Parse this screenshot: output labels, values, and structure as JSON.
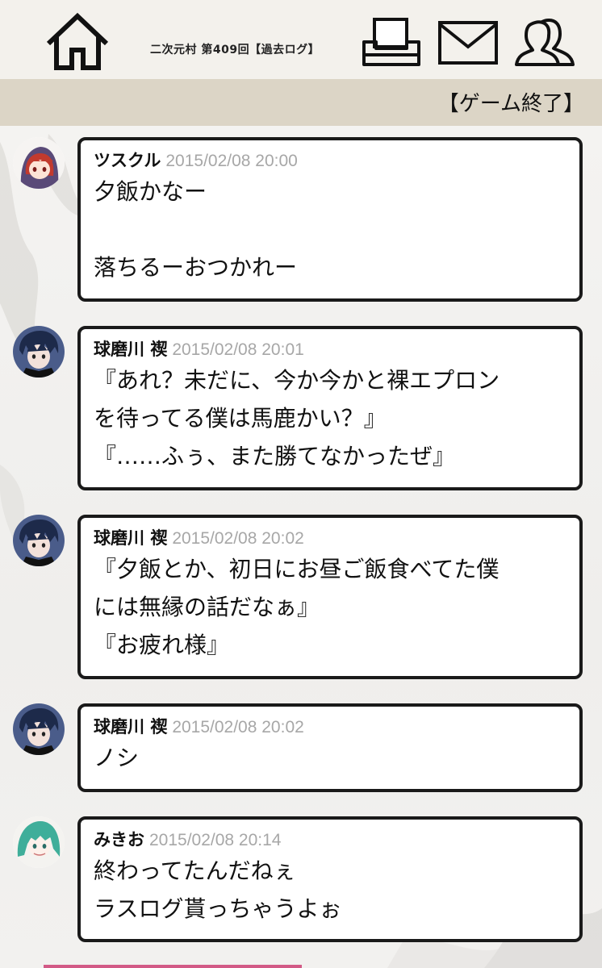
{
  "header": {
    "village_title": "二次元村 第409回【過去ログ】",
    "home_icon": "home-icon",
    "print_icon": "print-icon",
    "mail_icon": "mail-icon",
    "users_icon": "users-icon"
  },
  "status": {
    "text": "【ゲーム終了】"
  },
  "messages": [
    {
      "name": "ツスクル",
      "time": "2015/02/08 20:00",
      "lines": [
        "夕飯かなー",
        "",
        "落ちるーおつかれー"
      ],
      "avatar": "avatar-red-hair-hood"
    },
    {
      "name": "球磨川 禊",
      "time": "2015/02/08 20:01",
      "lines": [
        "『あれ？未だに、今か今かと裸エプロン",
        "を待ってる僕は馬鹿かい？』",
        "『……ふぅ、また勝てなかったぜ』"
      ],
      "avatar": "avatar-dark-hair"
    },
    {
      "name": "球磨川 禊",
      "time": "2015/02/08 20:02",
      "lines": [
        "『夕飯とか、初日にお昼ご飯食べてた僕",
        "には無縁の話だなぁ』",
        "『お疲れ様』"
      ],
      "avatar": "avatar-dark-hair"
    },
    {
      "name": "球磨川 禊",
      "time": "2015/02/08 20:02",
      "lines": [
        "ノシ"
      ],
      "avatar": "avatar-dark-hair"
    },
    {
      "name": "みきお",
      "time": "2015/02/08 20:14",
      "lines": [
        "終わってたんだねぇ",
        "ラスログ貰っちゃうよぉ"
      ],
      "avatar": "avatar-green-hair"
    }
  ]
}
